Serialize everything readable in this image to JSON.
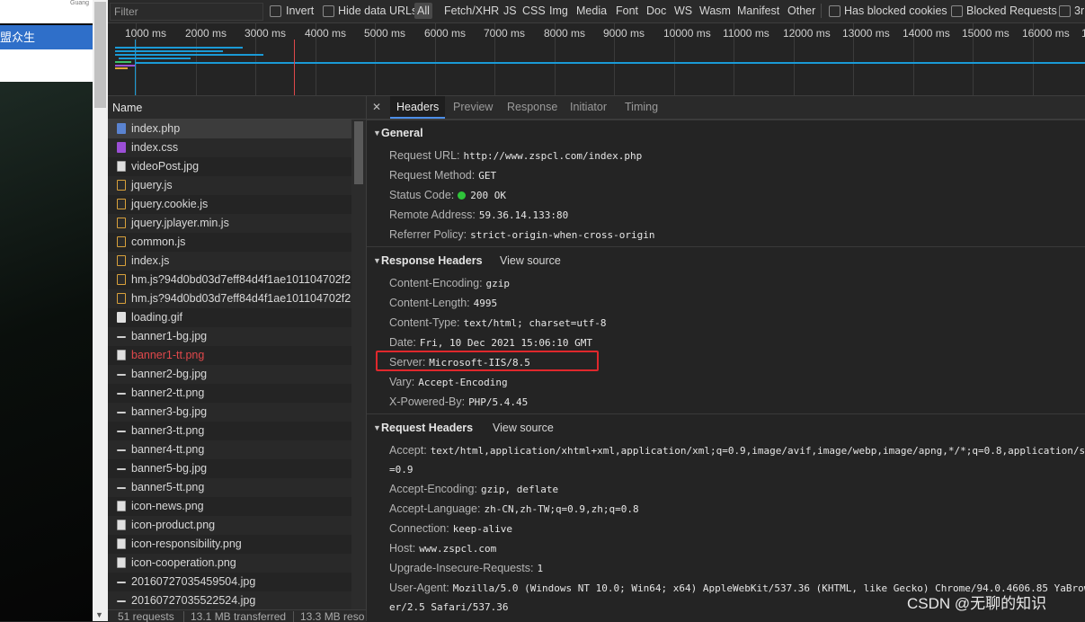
{
  "page": {
    "header_snippet": "Guang",
    "banner_text": "盟众生"
  },
  "filter_bar": {
    "filter_placeholder": "Filter",
    "invert_label": "Invert",
    "hide_data_urls_label": "Hide data URLs",
    "types": [
      "All",
      "Fetch/XHR",
      "JS",
      "CSS",
      "Img",
      "Media",
      "Font",
      "Doc",
      "WS",
      "Wasm",
      "Manifest",
      "Other"
    ],
    "active_type": "All",
    "has_blocked_cookies_label": "Has blocked cookies",
    "blocked_requests_label": "Blocked Requests",
    "third_party_label": "3r"
  },
  "overview": {
    "ticks": [
      "1000 ms",
      "2000 ms",
      "3000 ms",
      "4000 ms",
      "5000 ms",
      "6000 ms",
      "7000 ms",
      "8000 ms",
      "9000 ms",
      "10000 ms",
      "11000 ms",
      "12000 ms",
      "13000 ms",
      "14000 ms",
      "15000 ms",
      "16000 ms",
      "1"
    ]
  },
  "request_list": {
    "column_name": "Name",
    "selected_index": 0,
    "rows": [
      {
        "name": "index.php",
        "icon": "document-icon",
        "kind": "doc",
        "failed": false
      },
      {
        "name": "index.css",
        "icon": "stylesheet-icon",
        "kind": "css",
        "failed": false
      },
      {
        "name": "videoPost.jpg",
        "icon": "image-icon",
        "kind": "img",
        "failed": false
      },
      {
        "name": "jquery.js",
        "icon": "script-icon",
        "kind": "js",
        "failed": false
      },
      {
        "name": "jquery.cookie.js",
        "icon": "script-icon",
        "kind": "js",
        "failed": false
      },
      {
        "name": "jquery.jplayer.min.js",
        "icon": "script-icon",
        "kind": "js",
        "failed": false
      },
      {
        "name": "common.js",
        "icon": "script-icon",
        "kind": "js",
        "failed": false
      },
      {
        "name": "index.js",
        "icon": "script-icon",
        "kind": "js",
        "failed": false
      },
      {
        "name": "hm.js?94d0bd03d7eff84d4f1ae101104702f2",
        "icon": "script-icon",
        "kind": "js",
        "failed": false
      },
      {
        "name": "hm.js?94d0bd03d7eff84d4f1ae101104702f2",
        "icon": "script-icon",
        "kind": "js",
        "failed": false
      },
      {
        "name": "loading.gif",
        "icon": "image-icon",
        "kind": "gif",
        "failed": false
      },
      {
        "name": "banner1-bg.jpg",
        "icon": "image-icon",
        "kind": "dash",
        "failed": false
      },
      {
        "name": "banner1-tt.png",
        "icon": "image-icon",
        "kind": "img",
        "failed": true
      },
      {
        "name": "banner2-bg.jpg",
        "icon": "image-icon",
        "kind": "dash",
        "failed": false
      },
      {
        "name": "banner2-tt.png",
        "icon": "image-icon",
        "kind": "dash",
        "failed": false
      },
      {
        "name": "banner3-bg.jpg",
        "icon": "image-icon",
        "kind": "dash",
        "failed": false
      },
      {
        "name": "banner3-tt.png",
        "icon": "image-icon",
        "kind": "dash",
        "failed": false
      },
      {
        "name": "banner4-tt.png",
        "icon": "image-icon",
        "kind": "dash",
        "failed": false
      },
      {
        "name": "banner5-bg.jpg",
        "icon": "image-icon",
        "kind": "dash",
        "failed": false
      },
      {
        "name": "banner5-tt.png",
        "icon": "image-icon",
        "kind": "dash",
        "failed": false
      },
      {
        "name": "icon-news.png",
        "icon": "image-icon",
        "kind": "img",
        "failed": false
      },
      {
        "name": "icon-product.png",
        "icon": "image-icon",
        "kind": "img",
        "failed": false
      },
      {
        "name": "icon-responsibility.png",
        "icon": "image-icon",
        "kind": "img",
        "failed": false
      },
      {
        "name": "icon-cooperation.png",
        "icon": "image-icon",
        "kind": "img",
        "failed": false
      },
      {
        "name": "20160727035459504.jpg",
        "icon": "image-icon",
        "kind": "dash",
        "failed": false
      },
      {
        "name": "20160727035522524.jpg",
        "icon": "image-icon",
        "kind": "dash",
        "failed": false
      }
    ]
  },
  "status_bar": {
    "requests": "51 requests",
    "transferred": "13.1 MB transferred",
    "resources": "13.3 MB reso"
  },
  "detail": {
    "tabs": [
      "Headers",
      "Preview",
      "Response",
      "Initiator",
      "Timing"
    ],
    "active_tab": "Headers",
    "general": {
      "title": "General",
      "rows": [
        {
          "key": "Request URL:",
          "value": "http://www.zspcl.com/index.php"
        },
        {
          "key": "Request Method:",
          "value": "GET"
        },
        {
          "key": "Status Code:",
          "value": "200 OK",
          "status_dot": true
        },
        {
          "key": "Remote Address:",
          "value": "59.36.14.133:80"
        },
        {
          "key": "Referrer Policy:",
          "value": "strict-origin-when-cross-origin"
        }
      ]
    },
    "response_headers": {
      "title": "Response Headers",
      "view_source": "View source",
      "rows": [
        {
          "key": "Content-Encoding:",
          "value": "gzip"
        },
        {
          "key": "Content-Length:",
          "value": "4995"
        },
        {
          "key": "Content-Type:",
          "value": "text/html; charset=utf-8"
        },
        {
          "key": "Date:",
          "value": "Fri, 10 Dec 2021 15:06:10 GMT"
        },
        {
          "key": "Server:",
          "value": "Microsoft-IIS/8.5",
          "highlighted": true
        },
        {
          "key": "Vary:",
          "value": "Accept-Encoding"
        },
        {
          "key": "X-Powered-By:",
          "value": "PHP/5.4.45"
        }
      ]
    },
    "request_headers": {
      "title": "Request Headers",
      "view_source": "View source",
      "accept_key": "Accept:",
      "accept_value": "text/html,application/xhtml+xml,application/xml;q=0.9,image/avif,image/webp,image/apng,*/*;q=0.8,application/si",
      "accept_value_cont": "=0.9",
      "rows": [
        {
          "key": "Accept-Encoding:",
          "value": "gzip, deflate"
        },
        {
          "key": "Accept-Language:",
          "value": "zh-CN,zh-TW;q=0.9,zh;q=0.8"
        },
        {
          "key": "Connection:",
          "value": "keep-alive"
        },
        {
          "key": "Host:",
          "value": "www.zspcl.com"
        },
        {
          "key": "Upgrade-Insecure-Requests:",
          "value": "1"
        }
      ],
      "user_agent_key": "User-Agent:",
      "user_agent_value": "Mozilla/5.0 (Windows NT 10.0; Win64; x64) AppleWebKit/537.36 (KHTML, like Gecko) Chrome/94.0.4606.85 YaBrow",
      "user_agent_value_cont": "er/2.5 Safari/537.36"
    }
  },
  "watermark": "CSDN @无聊的知识",
  "colors": {
    "selected_tab_underline": "#4d8ee8",
    "highlight_box": "#e0282c",
    "status_ok": "#2fc43a",
    "failed_request": "#e0484b",
    "overview_line_blue": "#1a9ad6",
    "overview_line_red": "#e0484b"
  }
}
